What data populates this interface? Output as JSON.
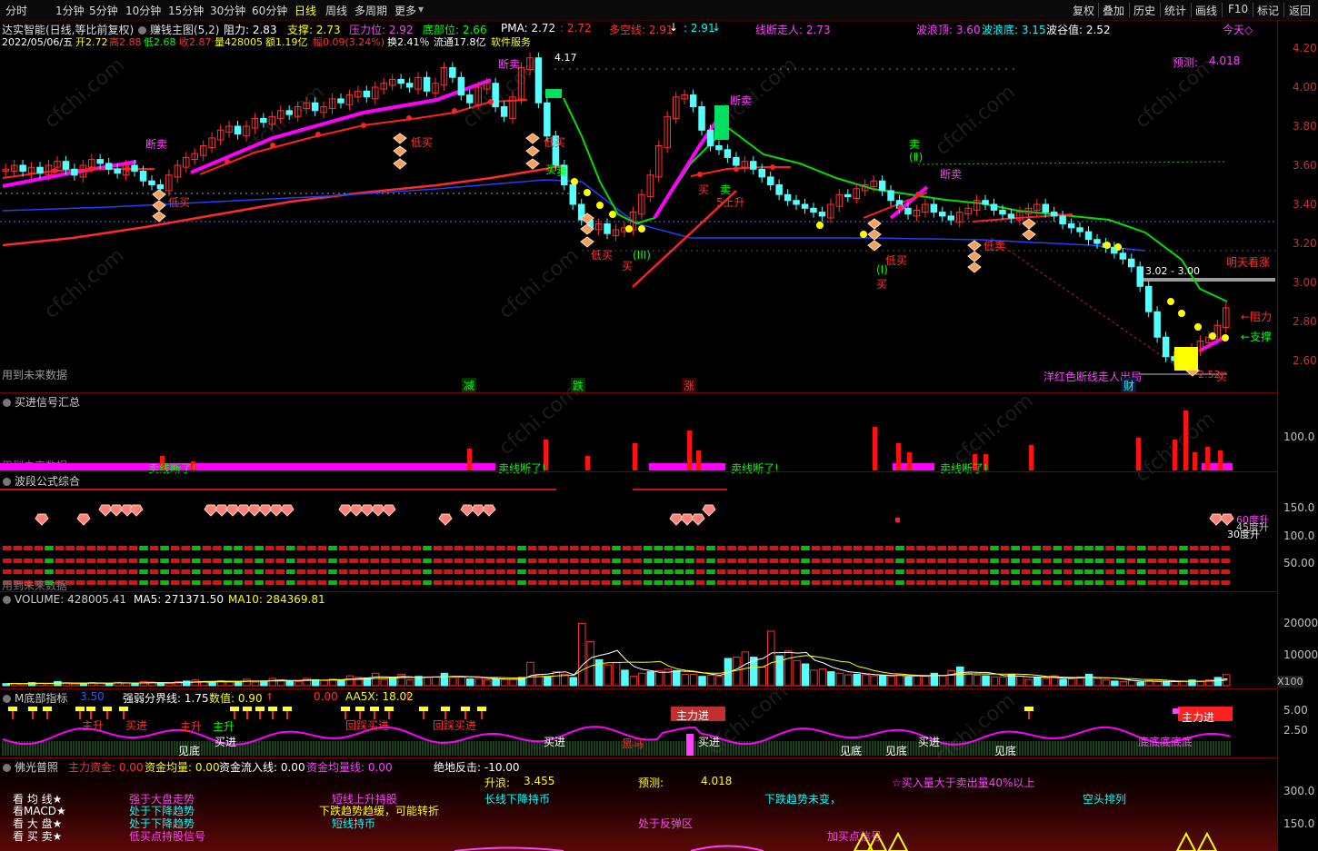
{
  "toolbar": {
    "periods": [
      "分时",
      "1分钟",
      "5分钟",
      "10分钟",
      "15分钟",
      "30分钟",
      "60分钟",
      "日线",
      "周线",
      "多周期",
      "更多"
    ],
    "active_period": "日线",
    "right_buttons": [
      "复权",
      "叠加",
      "历史",
      "统计",
      "画线",
      "F10",
      "标记",
      "返回"
    ]
  },
  "main_panel": {
    "stock_title": "达实智能(日线,等比前复权)",
    "indicator_name": "赚钱主图(5,2)",
    "resistance": "阻力: 2.83",
    "support": "支撑: 2.73",
    "pressure_level": "压力位: 2.92",
    "bottom_level": "底部位: 2.66",
    "pma": "PMA: 2.72",
    "pma_value2": ": 2.72",
    "multi_empty": "多空线: 2.91",
    "multi_empty2": ": 2.91",
    "line_break": "线断走人: 2.73",
    "wave_top": "波浪顶: 3.60",
    "wave_bottom": "波浪底: 3.15",
    "wave_valley": "波谷值: 2.52",
    "today_label": "今天◇",
    "info_line": {
      "date": "2022/05/06/五",
      "open": "开2.72",
      "high": "高2.88",
      "low": "低2.68",
      "close": "收2.87",
      "volume": "量428005",
      "amount": "额1.19亿",
      "change": "幅0.09(3.24%)",
      "turnover": "换2.41％",
      "float": "流通17.8亿",
      "industry": "软件服务"
    },
    "future_data_note": "用到未来数据",
    "peak_label": "4.17",
    "forecast": "预测:",
    "forecast_value": "4.018",
    "tomorrow": "明天看涨",
    "range_label": "3.02 - 3.00",
    "resist_arrow": "←阻力",
    "support_arrow": "←支撑",
    "exit_note": "洋红色断线走人出局",
    "low_price": "2.52",
    "buy_label_low": "买",
    "markers": {
      "sell_break": "断卖",
      "low_buy": "低买",
      "buy": "买",
      "sell": "卖",
      "up5": "5上升",
      "wave3": "(III)",
      "wave1": "(Ⅰ)",
      "wave2": "(Ⅱ)",
      "low_sell": "低卖",
      "jian": "减",
      "die": "跌",
      "zhang": "涨",
      "cai": "财"
    },
    "y_ticks": [
      "4.20",
      "4.00",
      "3.80",
      "3.60",
      "3.40",
      "3.20",
      "3.00",
      "2.80",
      "2.60"
    ]
  },
  "signal_panel": {
    "title": "买进信号汇总",
    "future_note": "用到未来数据",
    "sell_break_labels": [
      "卖线断了!",
      "卖线断了!",
      "卖线断了!",
      "卖线断了!"
    ],
    "y_tick": "100.0"
  },
  "wave_panel": {
    "title": "波段公式综合",
    "right_labels": [
      "60度升",
      "45度升",
      "30度升"
    ],
    "future_note": "用到未来数据",
    "y_ticks": [
      "150.0",
      "100.0",
      "50.00"
    ]
  },
  "volume_panel": {
    "title": "VOLUME: 428005.41",
    "ma5": "MA5: 271371.50",
    "ma10": "MA10: 284369.81",
    "y_ticks": [
      "20000",
      "10000"
    ],
    "unit": "X100",
    "chart_data": {
      "type": "bar",
      "title": "",
      "ylim": [
        0,
        28000
      ],
      "values_x100": [
        800,
        900,
        700,
        1200,
        900,
        800,
        1600,
        1000,
        700,
        900,
        1200,
        1100,
        900,
        1300,
        1000,
        800,
        1600,
        1400,
        1100,
        900,
        1500,
        1800,
        2200,
        1600,
        1300,
        1900,
        1500,
        1700,
        2500,
        1400,
        1800,
        2800,
        2200,
        1800,
        1600,
        2800,
        2300,
        2000,
        2600,
        2200,
        3800,
        3200,
        3000,
        4800,
        2400,
        3000,
        4400,
        2300,
        3600,
        3200,
        3400,
        4800,
        3200,
        3400,
        2600,
        2800,
        2200,
        2600,
        2400,
        2400,
        3200,
        9000,
        4400,
        3600,
        5400,
        4400,
        3200,
        24000,
        17000,
        10000,
        8000,
        9000,
        6000,
        3600,
        4800,
        5400,
        5800,
        6400,
        5800,
        4400,
        4400,
        3600,
        4000,
        3600,
        10500,
        11000,
        13000,
        11000,
        7200,
        21000,
        11500,
        13400,
        9700,
        8400,
        6000,
        6400,
        5400,
        4800,
        4200,
        4400,
        4200,
        3800,
        3800,
        3600,
        4400,
        3400,
        3800,
        3600,
        4800,
        3800,
        5800,
        7200,
        4800,
        4000,
        3800,
        3400,
        3400,
        4200,
        3600,
        2400,
        3200,
        2800,
        3800,
        2400,
        2600,
        3400,
        4400,
        2800,
        2200,
        1800,
        1600,
        2000,
        1400,
        2000,
        1500,
        1400,
        1600,
        1800,
        2200,
        1600,
        2200,
        3200,
        4280
      ]
    }
  },
  "m_bottom_panel": {
    "title": "M底部指标",
    "value1": "3.50",
    "strength": "强弱分界线: 1.75",
    "value": "数值: 0.90",
    "zero": "0.00",
    "aa5x": "AA5X: 18.02",
    "labels": [
      "主升",
      "主升",
      "买进",
      "见底",
      "买进",
      "主升",
      "主力进",
      "买进",
      "黑马",
      "买进",
      "见底",
      "见底",
      "买进",
      "见底",
      "底底底底底",
      "主力进",
      "回踩买进",
      "回踩买进"
    ],
    "y_ticks": [
      "5.00",
      "2.50"
    ]
  },
  "buddha_panel": {
    "title": "佛光普照",
    "main_funds": "主力资金: 0.00",
    "avg_funds": "资金均量: 0.00",
    "inflow": "资金流入线: 0.00",
    "avg_volume": "资金均量线: 0.00",
    "counter": "绝地反击: -10.00",
    "left_items": [
      "看 均 线★",
      "看MACD★",
      "看 大 盘★",
      "看 买 卖★"
    ],
    "status_col1": [
      "强于大盘走势",
      "处于下降趋势",
      "处于下降趋势",
      "低买点持股信号"
    ],
    "status_col2": [
      "短线上升持股",
      "下跌趋势趋缓，可能转折",
      "短线持币"
    ],
    "rise": "升浪:",
    "rise_value": "3.455",
    "forecast": "预测:",
    "forecast_value": "4.018",
    "long_line": "长线下降持币",
    "downtrend": "下跌趋势未变，",
    "rebound": "处于反弹区",
    "buy_more": "☆买入量大于卖出量40%以上",
    "short_arrange": "空头排列",
    "add_buy": "加买点信号",
    "y_ticks": [
      "300.0",
      "150.0"
    ]
  },
  "colors": {
    "up": "#ff3030",
    "down": "#54ffff",
    "magenta": "#ff00ff",
    "green": "#00e000",
    "yellow": "#ffff00",
    "blue": "#2040ff"
  }
}
